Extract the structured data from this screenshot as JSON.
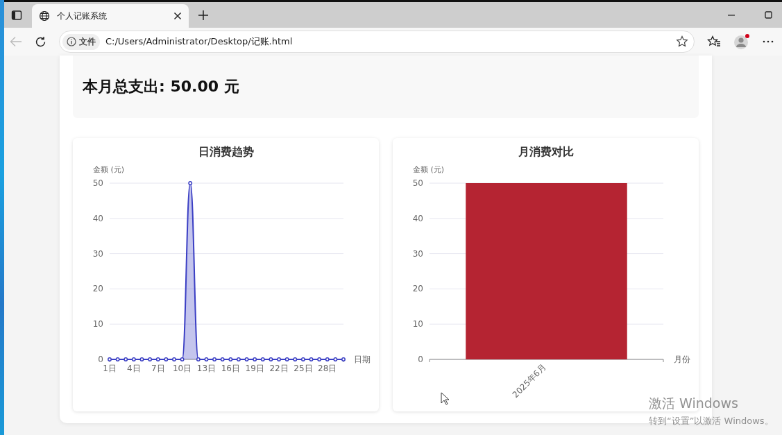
{
  "browser": {
    "tab": {
      "title": "个人记账系统"
    },
    "navigation": {
      "back_disabled": true
    },
    "address_bar": {
      "security_label": "文件",
      "url": "C:/Users/Administrator/Desktop/记账.html"
    }
  },
  "summary": {
    "text": "本月总支出: 50.00 元"
  },
  "charts": [
    {
      "title": "日消费趋势",
      "chart_data": {
        "type": "area",
        "xlabel": "日期",
        "ylabel": "金额 (元)",
        "x": [
          1,
          2,
          3,
          4,
          5,
          6,
          7,
          8,
          9,
          10,
          11,
          12,
          13,
          14,
          15,
          16,
          17,
          18,
          19,
          20,
          21,
          22,
          23,
          24,
          25,
          26,
          27,
          28,
          29,
          30
        ],
        "xlim": [
          1,
          30
        ],
        "grid": true,
        "series": [
          {
            "color": "#3b3fc4",
            "values": [
              0,
              0,
              0,
              0,
              0,
              0,
              0,
              0,
              0,
              0,
              50,
              0,
              0,
              0,
              0,
              0,
              0,
              0,
              0,
              0,
              0,
              0,
              0,
              0,
              0,
              0,
              0,
              0,
              0,
              0
            ]
          }
        ],
        "ylim": [
          0,
          50
        ],
        "yticks": [
          0,
          10,
          20,
          30,
          40,
          50
        ],
        "xticks": [
          {
            "value": 1,
            "label": "1日"
          },
          {
            "value": 4,
            "label": "4日"
          },
          {
            "value": 7,
            "label": "7日"
          },
          {
            "value": 10,
            "label": "10日"
          },
          {
            "value": 13,
            "label": "13日"
          },
          {
            "value": 16,
            "label": "16日"
          },
          {
            "value": 19,
            "label": "19日"
          },
          {
            "value": 22,
            "label": "22日"
          },
          {
            "value": 25,
            "label": "25日"
          },
          {
            "value": 28,
            "label": "28日"
          }
        ]
      }
    },
    {
      "title": "月消费对比",
      "chart_data": {
        "type": "bar",
        "xlabel": "月份",
        "ylabel": "金额 (元)",
        "categories": [
          "2025年6月"
        ],
        "series": [
          {
            "color": "#b52432",
            "values": [
              50
            ]
          }
        ],
        "ylim": [
          0,
          50
        ],
        "yticks": [
          0,
          10,
          20,
          30,
          40,
          50
        ],
        "grid": true
      }
    }
  ],
  "os_overlay": {
    "line_1": "激活 Windows",
    "line_2": "转到“设置”以激活 Windows。"
  }
}
